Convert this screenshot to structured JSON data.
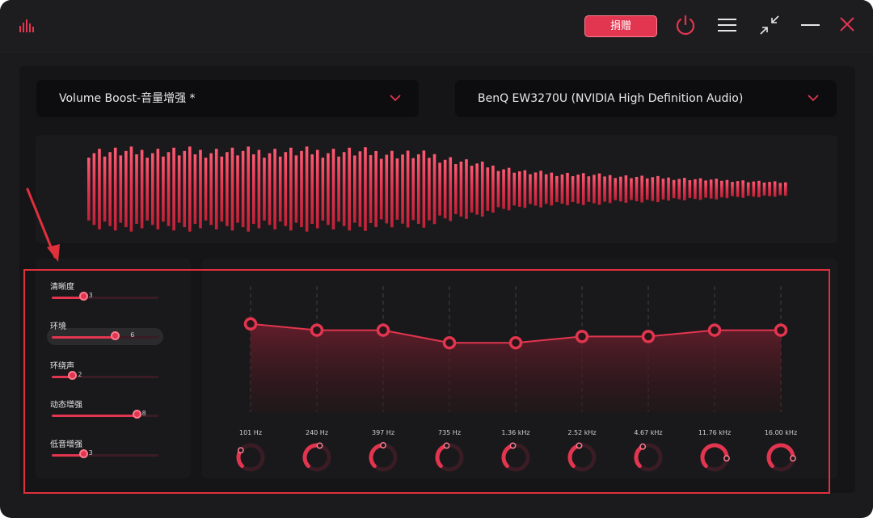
{
  "titlebar": {
    "donate_label": "捐赠",
    "icons": [
      "equalizer-logo-icon",
      "power-icon",
      "menu-icon",
      "collapse-icon",
      "minimize-icon",
      "close-icon"
    ]
  },
  "preset_select": {
    "value": "Volume Boost-音量增强 *"
  },
  "device_select": {
    "value": "BenQ EW3270U (NVIDIA High Definition Audio)"
  },
  "sliders": [
    {
      "label": "清晰度",
      "value": "3",
      "level": 0.3
    },
    {
      "label": "环境",
      "value": "6",
      "level": 0.6
    },
    {
      "label": "环绕声",
      "value": "2",
      "level": 0.2
    },
    {
      "label": "动态增强",
      "value": "8",
      "level": 0.8
    },
    {
      "label": "低音增强",
      "value": "3",
      "level": 0.3
    }
  ],
  "equalizer": {
    "bands": [
      {
        "freq": "101 Hz",
        "level": 0.7,
        "knob": 0.3
      },
      {
        "freq": "240 Hz",
        "level": 0.65,
        "knob": 0.55
      },
      {
        "freq": "397 Hz",
        "level": 0.65,
        "knob": 0.5
      },
      {
        "freq": "735 Hz",
        "level": 0.55,
        "knob": 0.45
      },
      {
        "freq": "1.36 kHz",
        "level": 0.55,
        "knob": 0.45
      },
      {
        "freq": "2.52 kHz",
        "level": 0.6,
        "knob": 0.45
      },
      {
        "freq": "4.67 kHz",
        "level": 0.6,
        "knob": 0.4
      },
      {
        "freq": "11.76 kHz",
        "level": 0.65,
        "knob": 0.85
      },
      {
        "freq": "16.00 kHz",
        "level": 0.65,
        "knob": 0.85
      }
    ]
  },
  "colors": {
    "accent": "#e2354f",
    "background": "#1b1b1d",
    "annotation": "#e0303c"
  }
}
